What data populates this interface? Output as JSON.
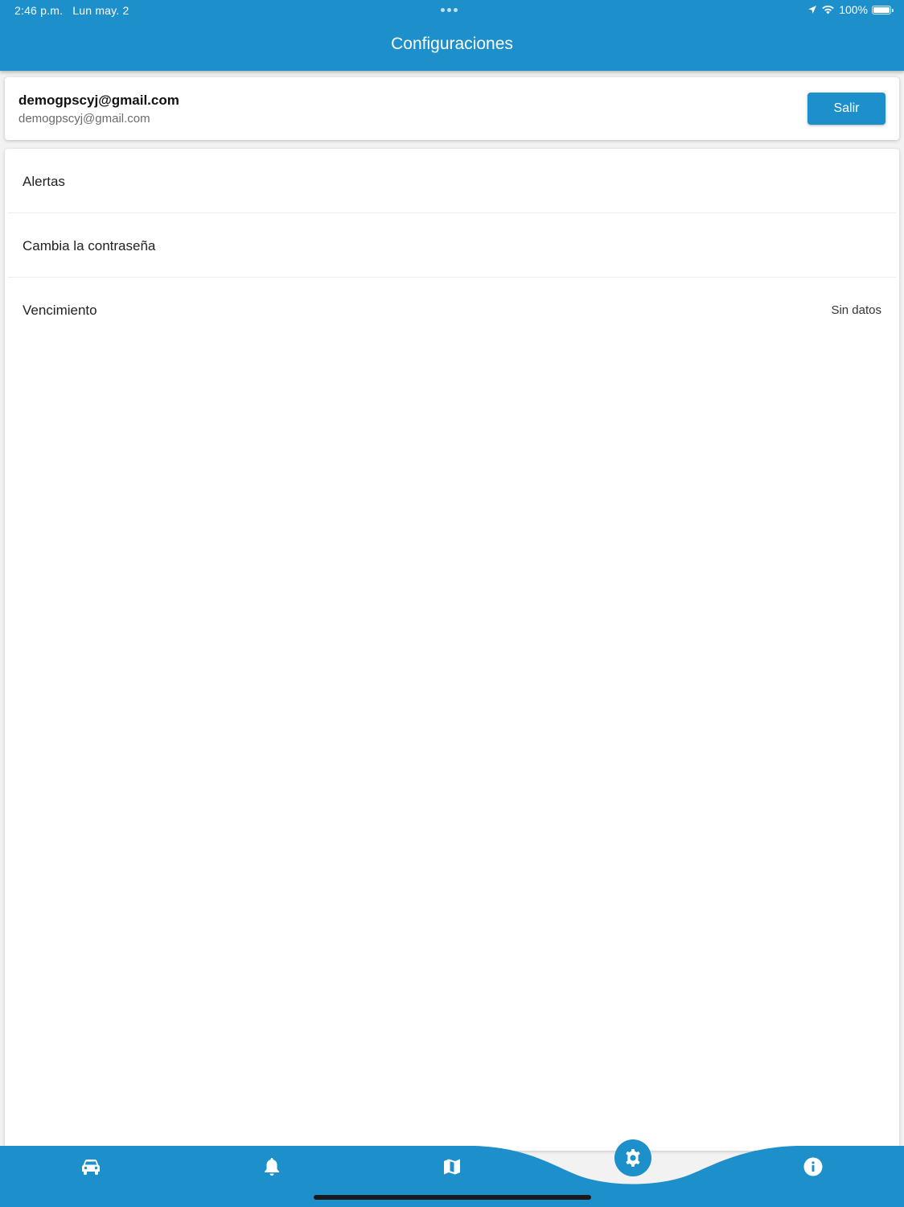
{
  "status_bar": {
    "time": "2:46 p.m.",
    "date": "Lun may. 2",
    "battery": "100%"
  },
  "header": {
    "title": "Configuraciones"
  },
  "account": {
    "name": "demogpscyj@gmail.com",
    "email": "demogpscyj@gmail.com",
    "logout_label": "Salir"
  },
  "settings": {
    "items": [
      {
        "label": "Alertas",
        "value": ""
      },
      {
        "label": "Cambia la contraseña",
        "value": ""
      },
      {
        "label": "Vencimiento",
        "value": "Sin datos"
      }
    ]
  },
  "bottom_nav": {
    "items": [
      {
        "icon": "car-icon"
      },
      {
        "icon": "bell-icon"
      },
      {
        "icon": "map-icon"
      },
      {
        "icon": "gear-icon",
        "active": true
      },
      {
        "icon": "info-icon"
      }
    ]
  },
  "colors": {
    "primary": "#1d8fca",
    "background": "#ffffff",
    "text": "#222222"
  }
}
